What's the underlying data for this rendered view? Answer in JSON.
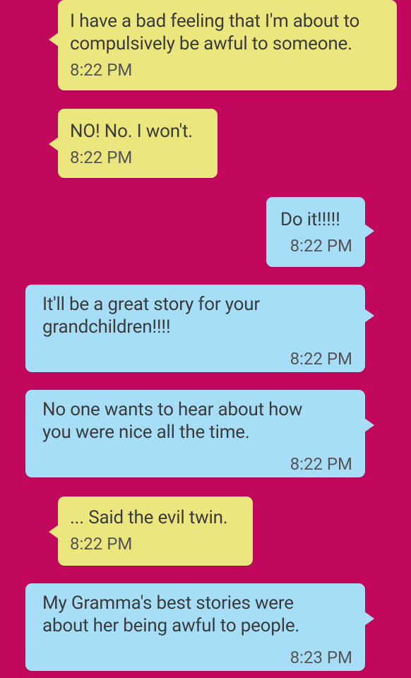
{
  "messages": [
    {
      "side": "in",
      "text": "I have a bad feeling that I'm about to\ncompulsively be awful to someone.",
      "time": "8:22 PM"
    },
    {
      "side": "in",
      "text": "NO! No. I won't.",
      "time": "8:22 PM"
    },
    {
      "side": "out",
      "text": "Do it!!!!!",
      "time": "8:22 PM"
    },
    {
      "side": "out",
      "text": "It'll be a great story for your\ngrandchildren!!!!",
      "time": "8:22 PM"
    },
    {
      "side": "out",
      "text": "No one wants to hear about how\nyou were nice all the time.",
      "time": "8:22 PM"
    },
    {
      "side": "in",
      "text": "... Said the evil twin.",
      "time": "8:22 PM"
    },
    {
      "side": "out",
      "text": "My Gramma's best stories were\nabout her being awful to people.",
      "time": "8:23 PM"
    }
  ],
  "colors": {
    "background": "#c2085d",
    "incoming_bubble": "#ece67e",
    "outgoing_bubble": "#a7def7"
  }
}
